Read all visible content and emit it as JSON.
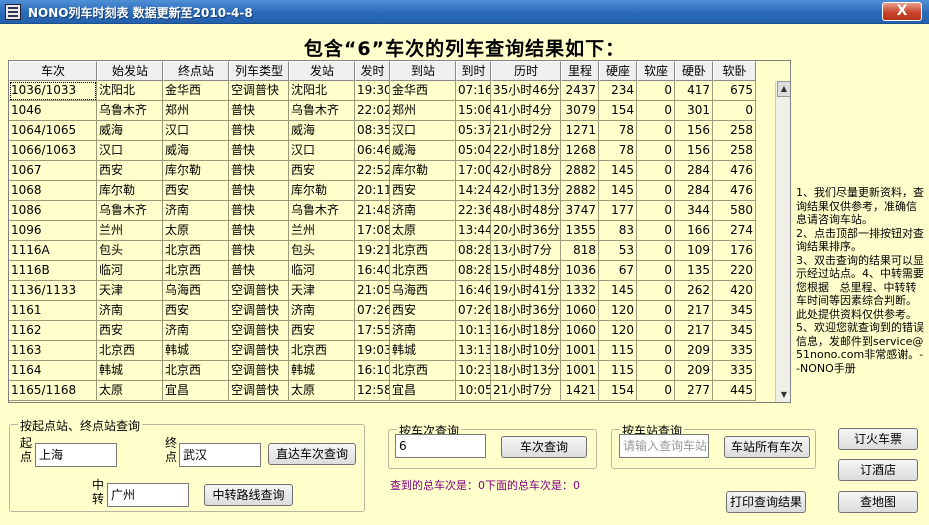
{
  "window": {
    "title": "NONO列车时刻表  数据更新至2010-4-8",
    "close_label": "X"
  },
  "heading": "包含“6”车次的列车查询结果如下：",
  "table": {
    "columns": [
      "车次",
      "始发站",
      "终点站",
      "列车类型",
      "发站",
      "发时",
      "到站",
      "到时",
      "历时",
      "里程",
      "硬座",
      "软座",
      "硬卧",
      "软卧"
    ],
    "rows": [
      [
        "1036/1033",
        "沈阳北",
        "金华西",
        "空调普快",
        "沈阳北",
        "19:30",
        "金华西",
        "07:16",
        "35小时46分",
        "2437",
        "234",
        "0",
        "417",
        "675"
      ],
      [
        "1046",
        "乌鲁木齐",
        "郑州",
        "普快",
        "乌鲁木齐",
        "22:02",
        "郑州",
        "15:06",
        "41小时4分",
        "3079",
        "154",
        "0",
        "301",
        "0"
      ],
      [
        "1064/1065",
        "威海",
        "汉口",
        "普快",
        "威海",
        "08:35",
        "汉口",
        "05:37",
        "21小时2分",
        "1271",
        "78",
        "0",
        "156",
        "258"
      ],
      [
        "1066/1063",
        "汉口",
        "威海",
        "普快",
        "汉口",
        "06:46",
        "威海",
        "05:04",
        "22小时18分",
        "1268",
        "78",
        "0",
        "156",
        "258"
      ],
      [
        "1067",
        "西安",
        "库尔勒",
        "普快",
        "西安",
        "22:52",
        "库尔勒",
        "17:00",
        "42小时8分",
        "2882",
        "145",
        "0",
        "284",
        "476"
      ],
      [
        "1068",
        "库尔勒",
        "西安",
        "普快",
        "库尔勒",
        "20:11",
        "西安",
        "14:24",
        "42小时13分",
        "2882",
        "145",
        "0",
        "284",
        "476"
      ],
      [
        "1086",
        "乌鲁木齐",
        "济南",
        "普快",
        "乌鲁木齐",
        "21:48",
        "济南",
        "22:36",
        "48小时48分",
        "3747",
        "177",
        "0",
        "344",
        "580"
      ],
      [
        "1096",
        "兰州",
        "太原",
        "普快",
        "兰州",
        "17:08",
        "太原",
        "13:44",
        "20小时36分",
        "1355",
        "83",
        "0",
        "166",
        "274"
      ],
      [
        "1116A",
        "包头",
        "北京西",
        "普快",
        "包头",
        "19:21",
        "北京西",
        "08:28",
        "13小时7分",
        "818",
        "53",
        "0",
        "109",
        "176"
      ],
      [
        "1116B",
        "临河",
        "北京西",
        "普快",
        "临河",
        "16:40",
        "北京西",
        "08:28",
        "15小时48分",
        "1036",
        "67",
        "0",
        "135",
        "220"
      ],
      [
        "1136/1133",
        "天津",
        "乌海西",
        "空调普快",
        "天津",
        "21:05",
        "乌海西",
        "16:46",
        "19小时41分",
        "1332",
        "145",
        "0",
        "262",
        "420"
      ],
      [
        "1161",
        "济南",
        "西安",
        "空调普快",
        "济南",
        "07:26",
        "西安",
        "07:26",
        "18小时36分",
        "1060",
        "120",
        "0",
        "217",
        "345"
      ],
      [
        "1162",
        "西安",
        "济南",
        "空调普快",
        "西安",
        "17:55",
        "济南",
        "10:13",
        "16小时18分",
        "1060",
        "120",
        "0",
        "217",
        "345"
      ],
      [
        "1163",
        "北京西",
        "韩城",
        "空调普快",
        "北京西",
        "19:03",
        "韩城",
        "13:13",
        "18小时10分",
        "1001",
        "115",
        "0",
        "209",
        "335"
      ],
      [
        "1164",
        "韩城",
        "北京西",
        "空调普快",
        "韩城",
        "16:10",
        "北京西",
        "10:23",
        "18小时13分",
        "1001",
        "115",
        "0",
        "209",
        "335"
      ],
      [
        "1165/1168",
        "太原",
        "宜昌",
        "空调普快",
        "太原",
        "12:58",
        "宜昌",
        "10:05",
        "21小时7分",
        "1421",
        "154",
        "0",
        "277",
        "445"
      ]
    ]
  },
  "scrollbar": {
    "up": "▲",
    "down": "▼"
  },
  "notes": "1、我们尽量更新资料，查询结果仅供参考，准确信息请咨询车站。\n2、点击顶部一排按钮对查询结果排序。\n3、双击查询的结果可以显示经过站点。4、中转需要您根据   总里程、中转转车时间等因素综合判断。此处提供资料仅供参考。   5、欢迎您就查询到的错误信息，发邮件到service@51nono.com非常感谢。--NONO手册",
  "station_query": {
    "group_label": "按起点站、终点站查询",
    "start_label": "起点",
    "start_value": "上海",
    "end_label": "终点",
    "end_value": "武汉",
    "direct_button": "直达车次查询",
    "transfer_label": "中转",
    "transfer_value": "广州",
    "transfer_button": "中转路线查询"
  },
  "train_query": {
    "group_label": "按车次查询",
    "value": "6",
    "button": "车次查询"
  },
  "stop_query": {
    "group_label": "按车站查询",
    "placeholder": "请输入查询车站",
    "button": "车站所有车次"
  },
  "status_text": "查到的总车次是：0下面的总车次是：0",
  "print_button": "打印查询结果",
  "side_buttons": {
    "tickets": "订火车票",
    "hotel": "订酒店",
    "map": "查地图"
  }
}
